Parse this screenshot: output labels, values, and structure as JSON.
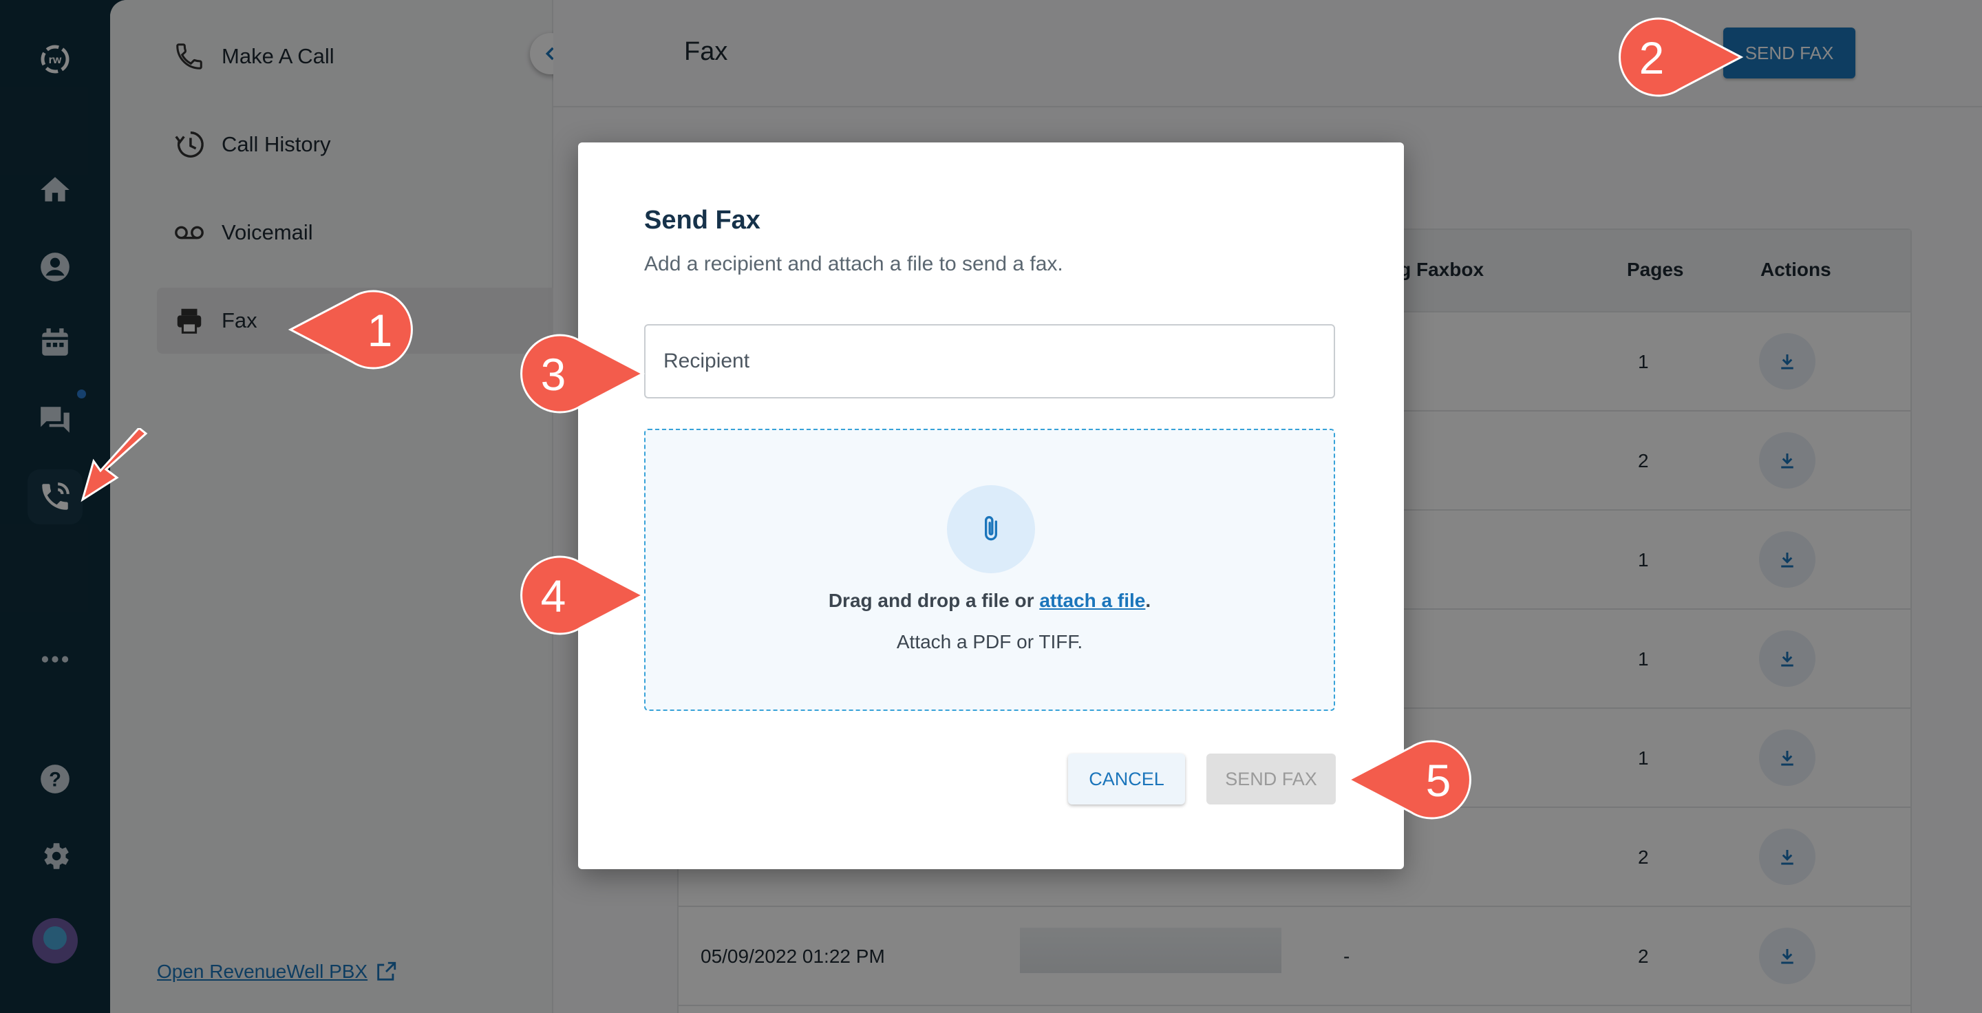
{
  "rail": {
    "items": [
      "logo-icon",
      "home-icon",
      "contacts-icon",
      "calendar-icon",
      "messages-icon",
      "phone-icon",
      "more-icon",
      "help-icon",
      "settings-icon",
      "avatar"
    ]
  },
  "subnav": {
    "items": [
      {
        "label": "Make A Call",
        "icon": "phone-call-icon"
      },
      {
        "label": "Call History",
        "icon": "history-icon"
      },
      {
        "label": "Voicemail",
        "icon": "voicemail-icon"
      },
      {
        "label": "Fax",
        "icon": "fax-icon",
        "selected": true
      }
    ],
    "footer_link": "Open RevenueWell PBX"
  },
  "page": {
    "title": "Fax",
    "send_fax_button": "SEND FAX"
  },
  "table": {
    "headers": {
      "faxbox": "ng Faxbox",
      "pages": "Pages",
      "actions": "Actions"
    },
    "rows": [
      {
        "pages": "1"
      },
      {
        "pages": "2"
      },
      {
        "pages": "1"
      },
      {
        "pages": "1"
      },
      {
        "pages": "1"
      },
      {
        "pages": "2"
      },
      {
        "date": "05/09/2022 01:22 PM",
        "faxbox": "-",
        "pages": "2"
      }
    ]
  },
  "modal": {
    "title": "Send Fax",
    "subtitle": "Add a recipient and attach a file to send a fax.",
    "recipient_placeholder": "Recipient",
    "drop_text": "Drag and drop a file or ",
    "drop_link": "attach a file",
    "drop_end": ".",
    "hint": "Attach a PDF or TIFF.",
    "cancel_label": "CANCEL",
    "send_label": "SEND FAX"
  },
  "callouts": [
    "1",
    "2",
    "3",
    "4",
    "5"
  ],
  "colors": {
    "accent": "#1b75bb",
    "callout": "#f35c4c",
    "rail": "#0f2e3e"
  }
}
